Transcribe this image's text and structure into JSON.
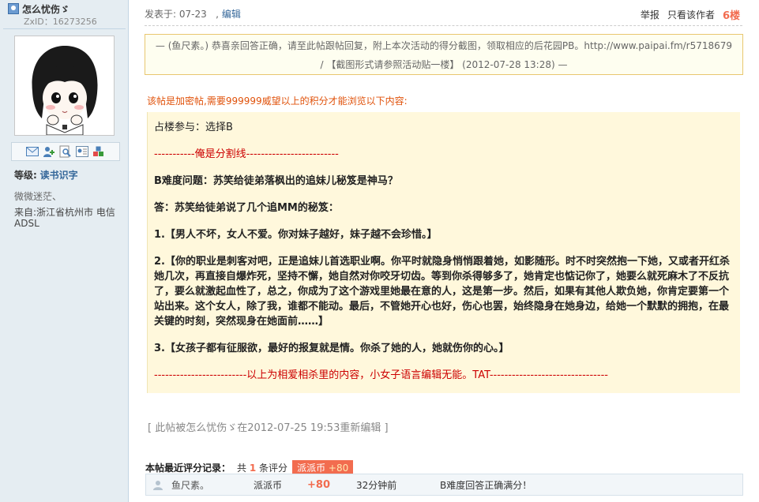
{
  "user": {
    "name": "怎么忧伤ゞ",
    "zxid": "ZxID：16273256",
    "level_label": "等级:",
    "level_value": "读书识字",
    "signature": "微微迷茫、",
    "from": "来自:浙江省杭州市 电信ADSL",
    "action_icons": [
      "mail-icon",
      "add-friend-icon",
      "search-icon",
      "profile-card-icon",
      "blocks-icon"
    ]
  },
  "post": {
    "posted_at": "发表于: 07-23",
    "edit_label": "编辑",
    "report_label": "举报",
    "author_only_label": "只看该作者",
    "floor": "6楼",
    "notice_line1": "— (鱼尺素。) 恭喜亲回答正确，请至此帖跟帖回复，附上本次活动的得分截图，领取相应的后花园PB。http://www.paipai.fm/r5718679",
    "notice_line2": "/ 【截图形式请参照活动贴一楼】 (2012-07-28 13:28) —",
    "encrypt_notice": "该帖是加密帖,需要999999威望以上的积分才能浏览以下内容:",
    "content": {
      "line1": "占楼参与：选择B",
      "divider_top": "-----------俺是分割线-------------------------",
      "question": "B难度问题：苏笑给徒弟落枫出的追妹儿秘笈是神马？",
      "answer": "答：苏笑给徒弟说了几个追MM的秘笈：",
      "item1": "1.【男人不坏，女人不爱。你对妹子越好，妹子越不会珍惜。】",
      "item2": "2.【你的职业是刺客对吧，正是追妹儿首选职业啊。你平时就隐身悄悄跟着她，如影随形。时不时突然抱一下她，又或者开红杀她几次，再直接自爆炸死，坚持不懈，她自然对你咬牙切齿。等到你杀得够多了，她肯定也惦记你了，她要么就死麻木了不反抗了，要么就激起血性了，总之，你成为了这个游戏里她最在意的人，这是第一步。然后，如果有其他人欺负她，你肯定要第一个站出来。这个女人，除了我，谁都不能动。最后，不管她开心也好，伤心也罢，始终隐身在她身边，给她一个默默的拥抱，在最关键的时刻，突然现身在她面前……】",
      "item3": "3.【女孩子都有征服欲，最好的报复就是情。你杀了她的人，她就伤你的心。】",
      "divider_bottom": "-------------------------以上为相爱相杀里的内容，小女子语言编辑无能。TAT--------------------------------"
    },
    "edited_note": "[ 此帖被怎么忧伤ゞ在2012-07-25 19:53重新编辑 ]"
  },
  "rating": {
    "heading": "本帖最近评分记录：",
    "total_prefix": "共",
    "total_count": "1",
    "total_suffix": "条评分",
    "tag_label": "派派币",
    "tag_value": "+80",
    "records": [
      {
        "user": "鱼尺素。",
        "type": "派派币",
        "score": "+80",
        "time": "32分钟前",
        "reason": "B难度回答正确满分！"
      }
    ]
  },
  "colors": {
    "sidebar_bg": "#e5edf2",
    "accent_orange": "#f26c4f",
    "link_blue": "#336699",
    "quote_bg": "#fff8dc",
    "divider_red": "#cc0000"
  }
}
